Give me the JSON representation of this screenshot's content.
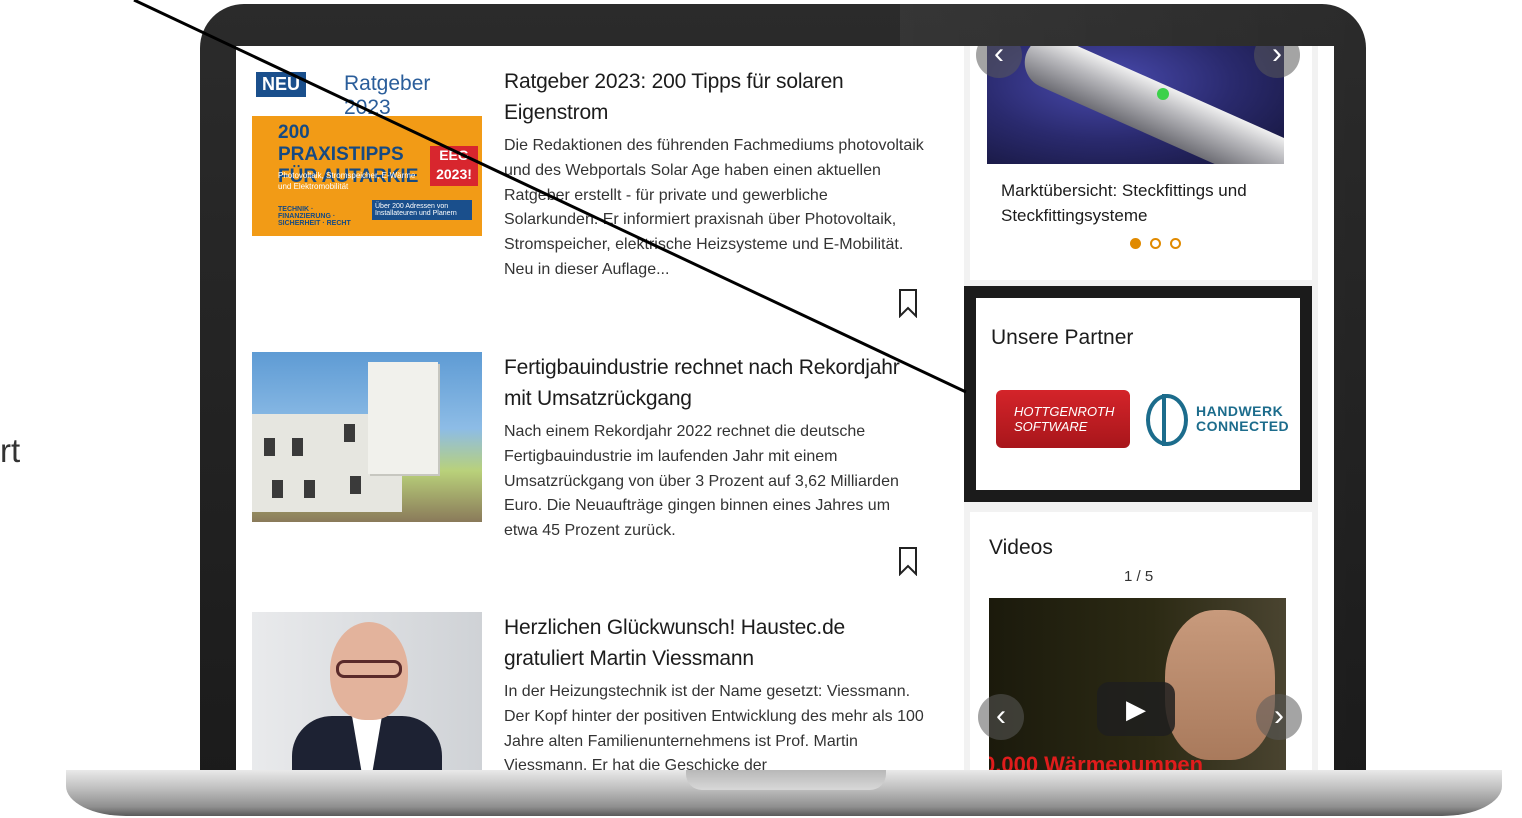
{
  "side_fragment": "rt",
  "articles": [
    {
      "title": "Ratgeber 2023: 200 Tipps für solaren Eigenstrom",
      "text": "Die Redaktionen des führenden Fachmediums photovoltaik und des Webportals Solar Age haben einen aktuellen Ratgeber erstellt - für private und gewerbliche Solarkunden. Er informiert praxisnah über Photovoltaik, Stromspeicher, elektrische Heizsysteme und E-Mobilität. Neu in dieser Auflage...",
      "thumb": {
        "neu": "NEU",
        "year": "Ratgeber 2023",
        "big": "200 PRAXISTIPPS FÜR AUTARKIE",
        "eeg": "EEG 2023!",
        "small": "Photovoltaik, Stromspeicher, E-Wärme und Elektromobilität",
        "bottom_left": "TECHNIK · FINANZIERUNG · SICHERHEIT · RECHT",
        "bottom_right": "Über 200 Adressen von Installateuren und Planern"
      }
    },
    {
      "title": "Fertigbauindustrie rechnet nach Rekordjahr mit Umsatzrückgang",
      "text": "Nach einem Rekordjahr 2022 rechnet die deutsche Fertigbauindustrie im laufenden Jahr mit einem Umsatzrückgang von über 3 Prozent auf 3,62 Milliarden Euro. Die Neuaufträge gingen binnen eines Jahres um etwa 45 Prozent zurück."
    },
    {
      "title": "Herzlichen Glückwunsch! Haustec.de gratuliert Martin Viessmann",
      "text": "In der Heizungstechnik ist der Name gesetzt: Viessmann. Der Kopf hinter der positiven Entwicklung des mehr als 100 Jahre alten Familienunternehmens ist Prof. Martin Viessmann. Er hat die Geschicke der"
    }
  ],
  "sidebar": {
    "slider": {
      "caption": "Marktübersicht: Steckfittings und Steckfittingsysteme",
      "prev_icon": "chevron-left-icon",
      "next_icon": "chevron-right-icon",
      "dots": 3,
      "active_dot": 1
    },
    "partner": {
      "title": "Unsere Partner",
      "logo1": "HOTTGENROTH SOFTWARE",
      "logo2_line1": "HANDWERK",
      "logo2_line2": "CONNECTED"
    },
    "videos": {
      "title": "Videos",
      "count": "1 / 5",
      "overlay_text": "0.000 Wärmepumpen",
      "play_icon": "play-icon"
    }
  },
  "colors": {
    "accent_orange": "#e08a00",
    "partner_red": "#c41e24",
    "partner_teal": "#1c6c8c",
    "bezel": "#1f1f1f"
  }
}
